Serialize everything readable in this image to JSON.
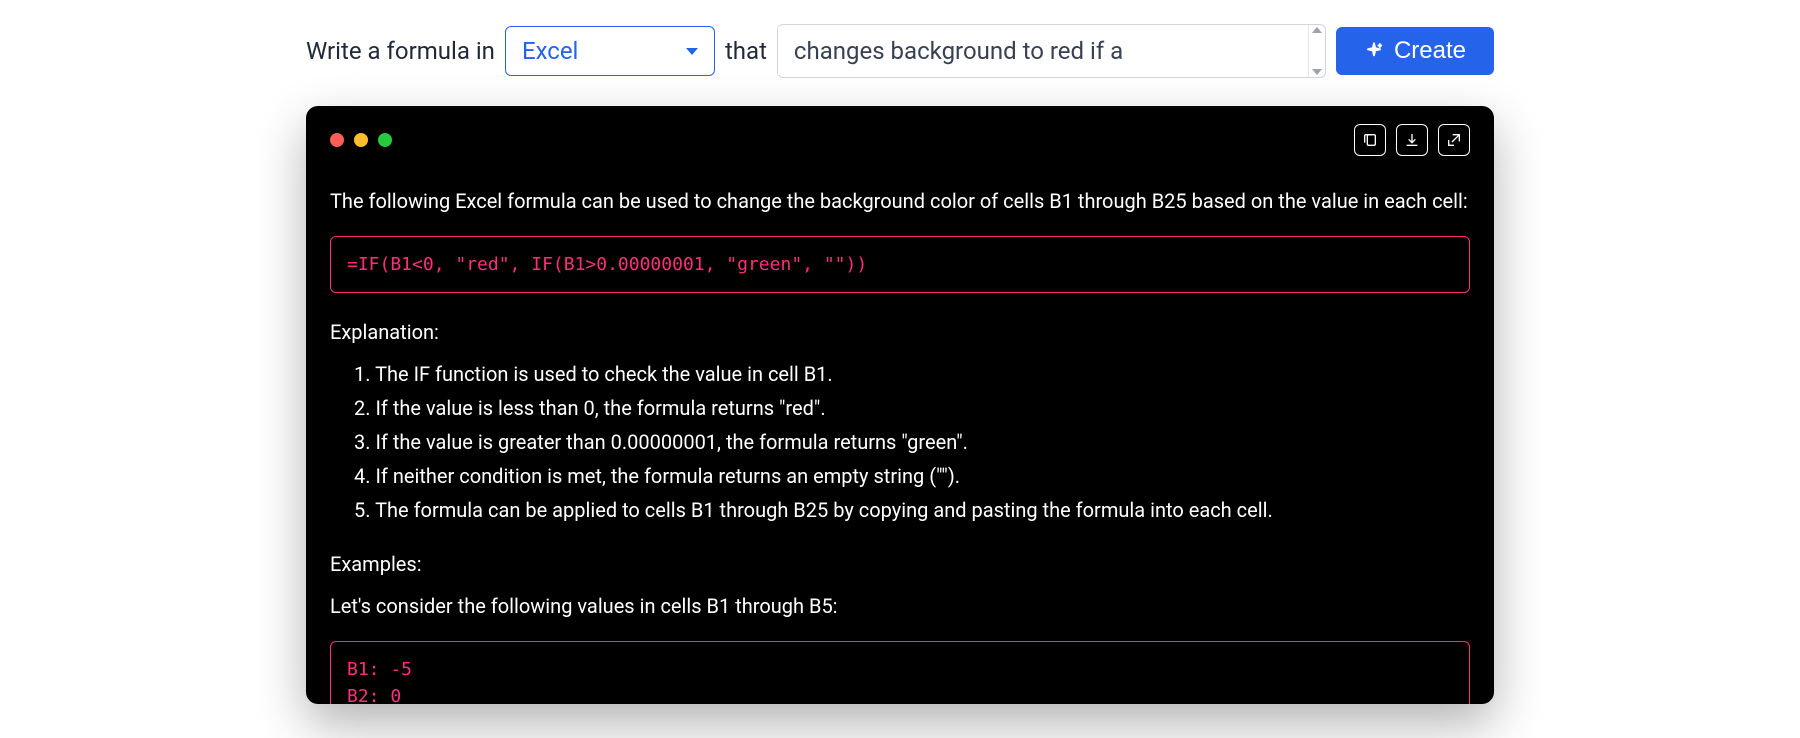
{
  "inputBar": {
    "prefixLabel": "Write a formula in",
    "dropdown": {
      "selected": "Excel"
    },
    "midLabel": "that",
    "promptInput": "changes background to red if a",
    "createButton": "Create"
  },
  "terminal": {
    "intro": "The following Excel formula can be used to change the background color of cells B1 through B25 based on the value in each cell:",
    "formula": "=IF(B1<0, \"red\", IF(B1>0.00000001, \"green\", \"\"))",
    "explanationHeading": "Explanation:",
    "explanationItems": [
      "1. The IF function is used to check the value in cell B1.",
      "2. If the value is less than 0, the formula returns \"red\".",
      "3. If the value is greater than 0.00000001, the formula returns \"green\".",
      "4. If neither condition is met, the formula returns an empty string (\"\").",
      "5. The formula can be applied to cells B1 through B25 by copying and pasting the formula into each cell."
    ],
    "examplesHeading": "Examples:",
    "examplesIntro": "Let's consider the following values in cells B1 through B5:",
    "exampleValues": "B1: -5\nB2: 0"
  }
}
